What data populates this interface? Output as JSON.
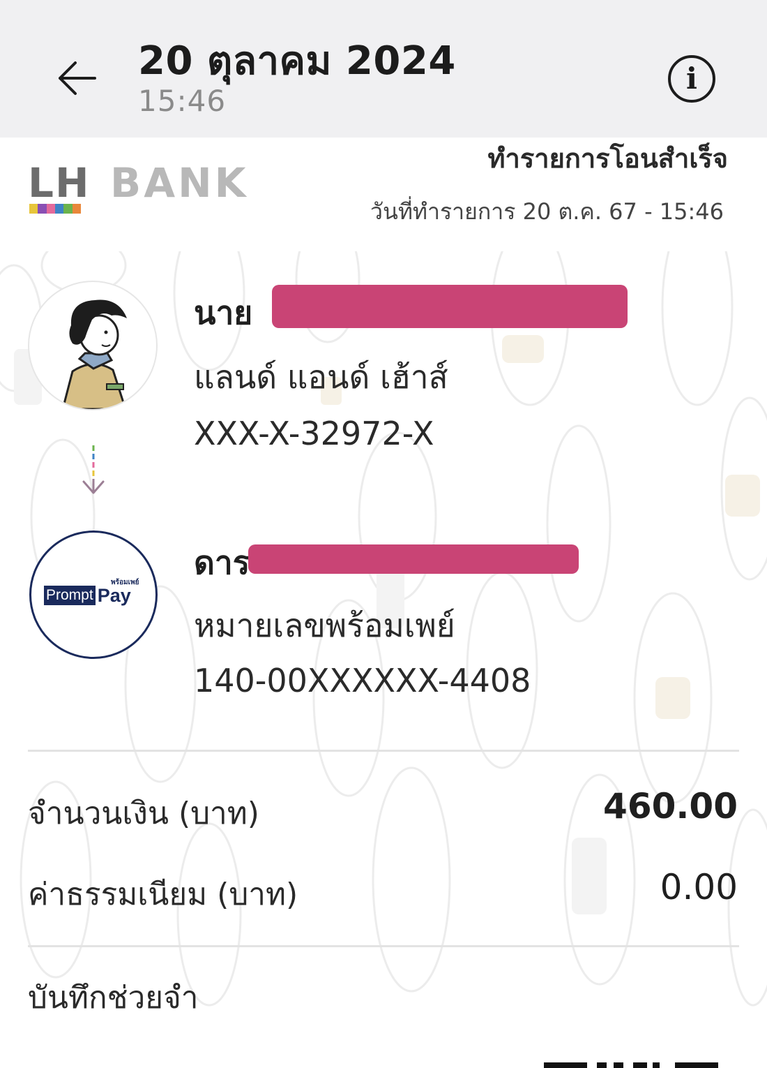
{
  "header": {
    "date": "20 ตุลาคม 2024",
    "time": "15:46"
  },
  "receipt": {
    "bank_lh": "LH",
    "bank_name": "BANK",
    "status_title": "ทำรายการโอนสำเร็จ",
    "transaction_date": "วันที่ทำรายการ 20 ต.ค. 67 - 15:46"
  },
  "sender": {
    "title_prefix": "นาย",
    "bank": "แลนด์ แอนด์ เฮ้าส์",
    "account": "XXX-X-32972-X"
  },
  "receiver": {
    "name_prefix": "ดาร",
    "method": "หมายเลขพร้อมเพย์",
    "account": "140-00XXXXXX-4408",
    "logo_thai": "พร้อมเพย์",
    "logo_prompt": "Prompt",
    "logo_pay": "Pay"
  },
  "amounts": {
    "amount_label": "จำนวนเงิน (บาท)",
    "amount_value": "460.00",
    "fee_label": "ค่าธรรมเนียม (บาท)",
    "fee_value": "0.00",
    "memo_label": "บันทึกช่วยจำ"
  },
  "colors": {
    "redaction": "#c94475",
    "promptpay_navy": "#1a2a5c",
    "appbar_bg": "#f0f0f2"
  },
  "icons": {
    "back": "arrow-left-icon",
    "info": "info-circle-icon",
    "flow": "arrow-down-icon"
  }
}
